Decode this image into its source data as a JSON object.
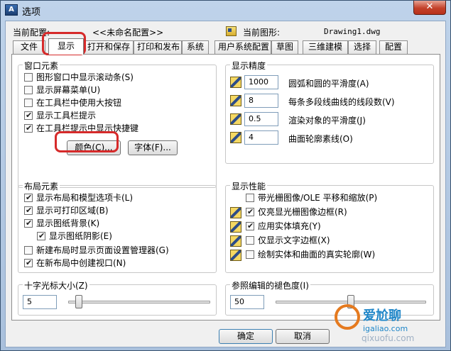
{
  "window": {
    "title": "选项",
    "close_glyph": "✕",
    "app_icon_text": "A"
  },
  "profile": {
    "current_profile_label": "当前配置:",
    "current_profile_value": "<<未命名配置>>",
    "current_drawing_label": "当前图形:",
    "current_drawing_value": "Drawing1.dwg"
  },
  "tabs": [
    {
      "label": "文件"
    },
    {
      "label": "显示"
    },
    {
      "label": "打开和保存"
    },
    {
      "label": "打印和发布"
    },
    {
      "label": "系统"
    },
    {
      "label": "用户系统配置"
    },
    {
      "label": "草图"
    },
    {
      "label": "三维建模"
    },
    {
      "label": "选择"
    },
    {
      "label": "配置"
    }
  ],
  "active_tab": "显示",
  "window_elements": {
    "title": "窗口元素",
    "checkboxes": [
      {
        "label": "图形窗口中显示滚动条(S)",
        "checked": false
      },
      {
        "label": "显示屏幕菜单(U)",
        "checked": false
      },
      {
        "label": "在工具栏中使用大按钮",
        "checked": false
      },
      {
        "label": "显示工具栏提示",
        "checked": true
      },
      {
        "label": "在工具栏提示中显示快捷键",
        "checked": true
      }
    ],
    "colors_button": "颜色(C)...",
    "fonts_button": "字体(F)..."
  },
  "display_resolution": {
    "title": "显示精度",
    "rows": [
      {
        "value": "1000",
        "label": "圆弧和圆的平滑度(A)"
      },
      {
        "value": "8",
        "label": "每条多段线曲线的线段数(V)"
      },
      {
        "value": "0.5",
        "label": "渲染对象的平滑度(J)"
      },
      {
        "value": "4",
        "label": "曲面轮廓素线(O)"
      }
    ]
  },
  "layout_elements": {
    "title": "布局元素",
    "checkboxes": [
      {
        "label": "显示布局和模型选项卡(L)",
        "checked": true
      },
      {
        "label": "显示可打印区域(B)",
        "checked": true
      },
      {
        "label": "显示图纸背景(K)",
        "checked": true
      },
      {
        "label": "显示图纸阴影(E)",
        "checked": true
      },
      {
        "label": "新建布局时显示页面设置管理器(G)",
        "checked": false
      },
      {
        "label": "在新布局中创建视口(N)",
        "checked": true
      }
    ]
  },
  "display_performance": {
    "title": "显示性能",
    "checkboxes": [
      {
        "label": "带光栅图像/OLE 平移和缩放(P)",
        "checked": false
      },
      {
        "label": "仅亮显光栅图像边框(R)",
        "checked": true
      },
      {
        "label": "应用实体填充(Y)",
        "checked": true
      },
      {
        "label": "仅显示文字边框(X)",
        "checked": false
      },
      {
        "label": "绘制实体和曲面的真实轮廓(W)",
        "checked": false
      }
    ]
  },
  "crosshair": {
    "title": "十字光标大小(Z)",
    "value": "5",
    "slider_fraction": 0.05
  },
  "xref_fading": {
    "title": "参照编辑的褪色度(I)",
    "value": "50",
    "slider_fraction": 0.5
  },
  "buttons": {
    "ok": "确定",
    "cancel": "取消"
  },
  "watermark": {
    "text_top": "爱尬聊",
    "text_url": "igaliao.com",
    "text_bottom": "qixuofu.com"
  },
  "colors": {
    "highlight": "#d62a2a",
    "title_bar": "#bfd3ea",
    "close_button": "#c3412a"
  }
}
